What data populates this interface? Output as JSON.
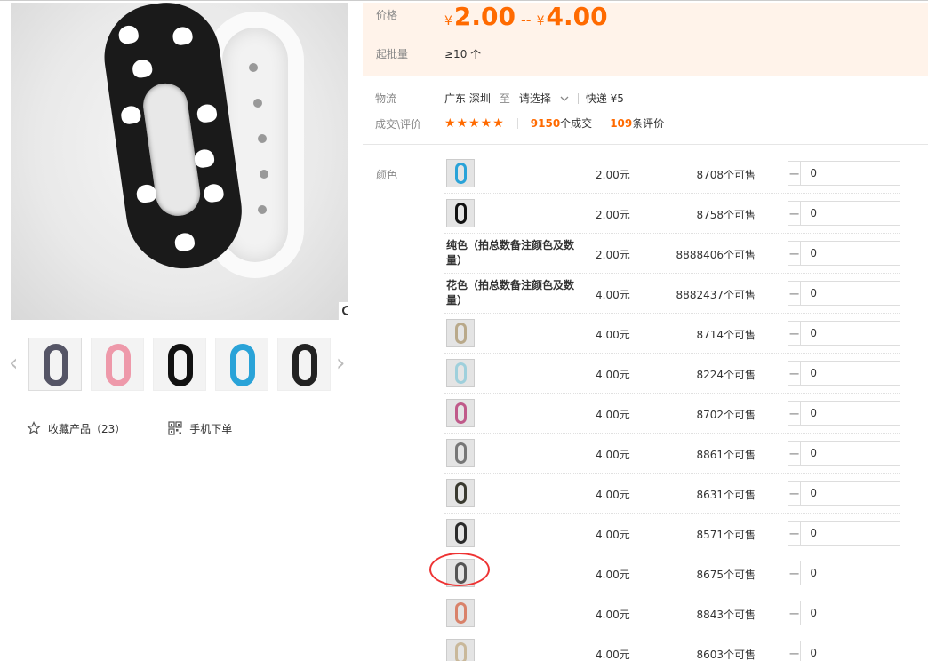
{
  "main_image": {
    "alt": ""
  },
  "gallery": {
    "prev_arrow": "‹",
    "next_arrow": "›",
    "thumbs": [
      {
        "color": "#556"
      },
      {
        "color": "#e9a"
      },
      {
        "color": "#111"
      },
      {
        "color": "#2aa3d8"
      },
      {
        "color": "#222"
      }
    ]
  },
  "actions": {
    "favorite": "收藏产品（23）",
    "mobile_order": "手机下单"
  },
  "price": {
    "label": "价格",
    "yen": "¥",
    "low": "2.00",
    "sep": "--",
    "high": "4.00",
    "accent": "#ff6a00"
  },
  "moq": {
    "label": "起批量",
    "value": "≥10 个"
  },
  "shipping": {
    "label": "物流",
    "from": "广东 深圳",
    "to_word": "至",
    "select": "请选择",
    "express": "快递 ¥5"
  },
  "rating": {
    "label": "成交\\评价",
    "stars": "★★★★★",
    "deals_num": "9150",
    "deals_unit": "个成交",
    "reviews_num": "109",
    "reviews_unit": "条评价"
  },
  "color_label": "颜色",
  "skus": [
    {
      "name": "",
      "thumb_color": "#2aa3d8",
      "price": "2.00元",
      "stock": "8708个可售",
      "qty": "0"
    },
    {
      "name": "",
      "thumb_color": "#111111",
      "price": "2.00元",
      "stock": "8758个可售",
      "qty": "0"
    },
    {
      "name": "纯色（拍总数备注颜色及数量）",
      "thumb_color": "",
      "price": "2.00元",
      "stock": "8888406个可售",
      "qty": "0"
    },
    {
      "name": "花色（拍总数备注颜色及数量）",
      "thumb_color": "",
      "price": "4.00元",
      "stock": "8882437个可售",
      "qty": "0"
    },
    {
      "name": "",
      "thumb_color": "#b9a98a",
      "price": "4.00元",
      "stock": "8714个可售",
      "qty": "0"
    },
    {
      "name": "",
      "thumb_color": "#9fd0dc",
      "price": "4.00元",
      "stock": "8224个可售",
      "qty": "0"
    },
    {
      "name": "",
      "thumb_color": "#c05a8a",
      "price": "4.00元",
      "stock": "8702个可售",
      "qty": "0"
    },
    {
      "name": "",
      "thumb_color": "#777777",
      "price": "4.00元",
      "stock": "8861个可售",
      "qty": "0"
    },
    {
      "name": "",
      "thumb_color": "#3a3a30",
      "price": "4.00元",
      "stock": "8631个可售",
      "qty": "0"
    },
    {
      "name": "",
      "thumb_color": "#2b2b2b",
      "price": "4.00元",
      "stock": "8571个可售",
      "qty": "0"
    },
    {
      "name": "",
      "thumb_color": "#555555",
      "price": "4.00元",
      "stock": "8675个可售",
      "qty": "0"
    },
    {
      "name": "",
      "thumb_color": "#d9826a",
      "price": "4.00元",
      "stock": "8843个可售",
      "qty": "0"
    },
    {
      "name": "",
      "thumb_color": "#c9b89a",
      "price": "4.00元",
      "stock": "8603个可售",
      "qty": "0"
    }
  ],
  "stepper": {
    "minus": "−",
    "plus": "+"
  },
  "annotation_color": "#e33333"
}
